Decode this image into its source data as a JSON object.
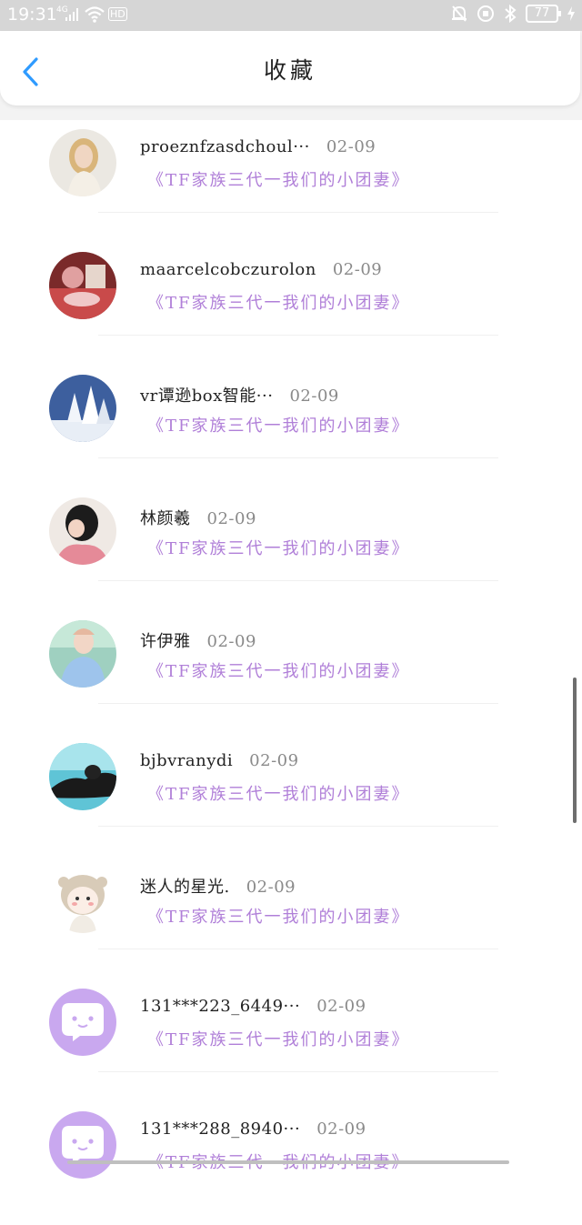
{
  "status_bar": {
    "time": "19:31",
    "signal_label": "4G",
    "hd_label": "HD",
    "battery": "77"
  },
  "header": {
    "title": "收藏"
  },
  "items": [
    {
      "name": "proeznfzasdchoul···",
      "date": "02-09",
      "message": "《TF家族三代一我们的小团妻》",
      "avatar": "photo-blonde-woman"
    },
    {
      "name": "maarcelcobczurolon",
      "date": "02-09",
      "message": "《TF家族三代一我们的小团妻》",
      "avatar": "photo-red-room"
    },
    {
      "name": "vr谭逊box智能···",
      "date": "02-09",
      "message": "《TF家族三代一我们的小团妻》",
      "avatar": "photo-snow-trees"
    },
    {
      "name": "林颜羲",
      "date": "02-09",
      "message": "《TF家族三代一我们的小团妻》",
      "avatar": "photo-girl-hair"
    },
    {
      "name": "许伊雅",
      "date": "02-09",
      "message": "《TF家族三代一我们的小团妻》",
      "avatar": "photo-girl-blue-shirt"
    },
    {
      "name": "bjbvranydi",
      "date": "02-09",
      "message": "《TF家族三代一我们的小团妻》",
      "avatar": "photo-swimmer"
    },
    {
      "name": "迷人的星光.",
      "date": "02-09",
      "message": "《TF家族三代一我们的小团妻》",
      "avatar": "cartoon-girl"
    },
    {
      "name": "131***223_6449···",
      "date": "02-09",
      "message": "《TF家族三代一我们的小团妻》",
      "avatar": "default-chat-bubble"
    },
    {
      "name": "131***288_8940···",
      "date": "02-09",
      "message": "《TF家族三代一我们的小团妻》",
      "avatar": "default-chat-bubble"
    }
  ],
  "colors": {
    "accent": "#2f9bff",
    "message": "#b07fd8",
    "date": "#8a8a8a",
    "default_avatar": "#c9a8ef"
  }
}
